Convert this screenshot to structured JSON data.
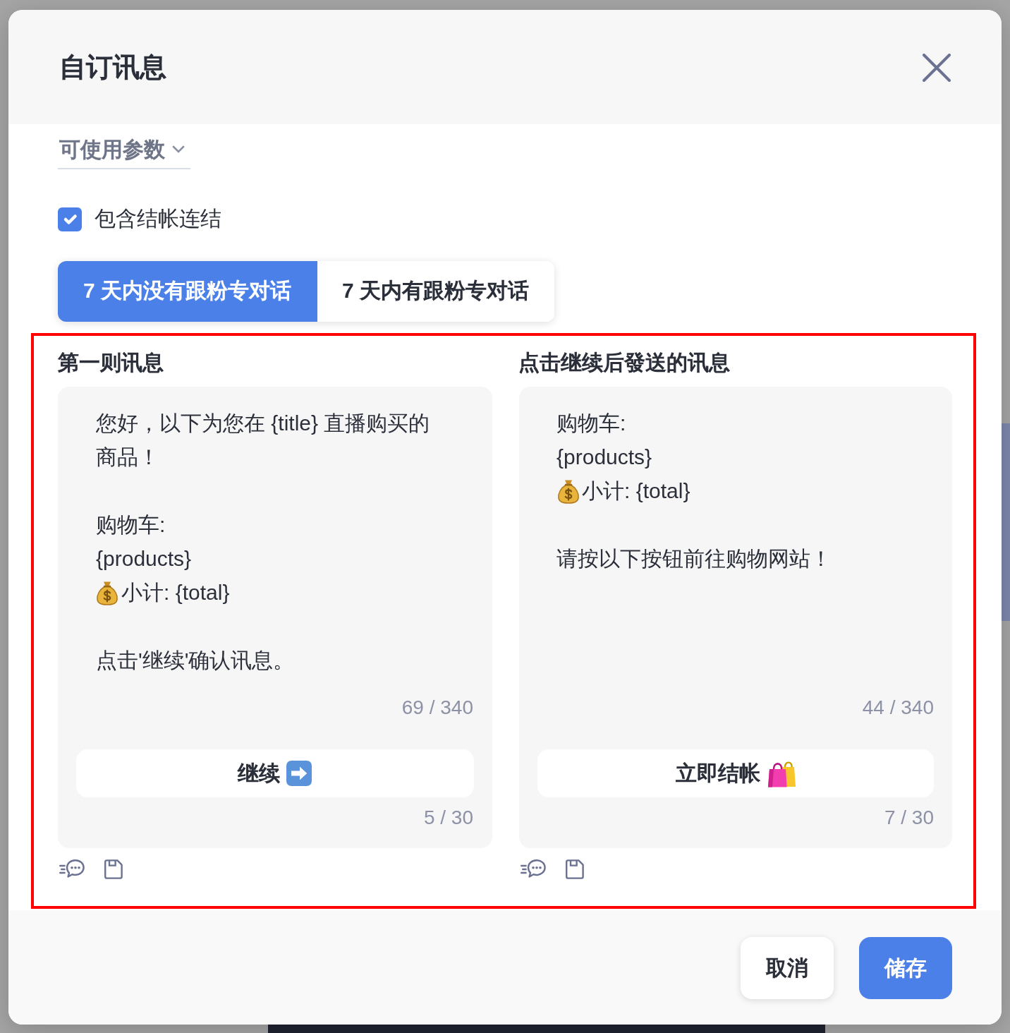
{
  "dialog": {
    "title": "自订讯息"
  },
  "parameters_dropdown": {
    "label": "可使用参数"
  },
  "include_checkout_link": {
    "label": "包含结帐连结",
    "checked": true
  },
  "tabs": [
    {
      "label": "7 天内没有跟粉专对话",
      "selected": true
    },
    {
      "label": "7 天内有跟粉专对话",
      "selected": false
    }
  ],
  "messages": [
    {
      "heading": "第一则讯息",
      "lines": [
        {
          "kind": "text",
          "text": "您好，以下为您在 {title} 直播购买的商品！"
        },
        {
          "kind": "blank"
        },
        {
          "kind": "text",
          "text": "购物车:"
        },
        {
          "kind": "text",
          "text": "{products}"
        },
        {
          "kind": "money",
          "text": "小计: {total}"
        },
        {
          "kind": "blank"
        },
        {
          "kind": "text",
          "text": "点击'继续'确认讯息。"
        }
      ],
      "text_count": "69 / 340",
      "button": {
        "label": "继续",
        "kind": "next"
      },
      "button_count": "5 / 30"
    },
    {
      "heading": "点击继续后發送的讯息",
      "lines": [
        {
          "kind": "text",
          "text": "购物车:"
        },
        {
          "kind": "text",
          "text": "{products}"
        },
        {
          "kind": "money",
          "text": "小计: {total}"
        },
        {
          "kind": "blank"
        },
        {
          "kind": "text",
          "text": "请按以下按钮前往购物网站！"
        }
      ],
      "text_count": "44 / 340",
      "button": {
        "label": "立即结帐",
        "kind": "checkout"
      },
      "button_count": "7 / 30"
    }
  ],
  "footer_buttons": [
    {
      "label": "取消",
      "kind": "secondary"
    },
    {
      "label": "储存",
      "kind": "primary"
    }
  ]
}
